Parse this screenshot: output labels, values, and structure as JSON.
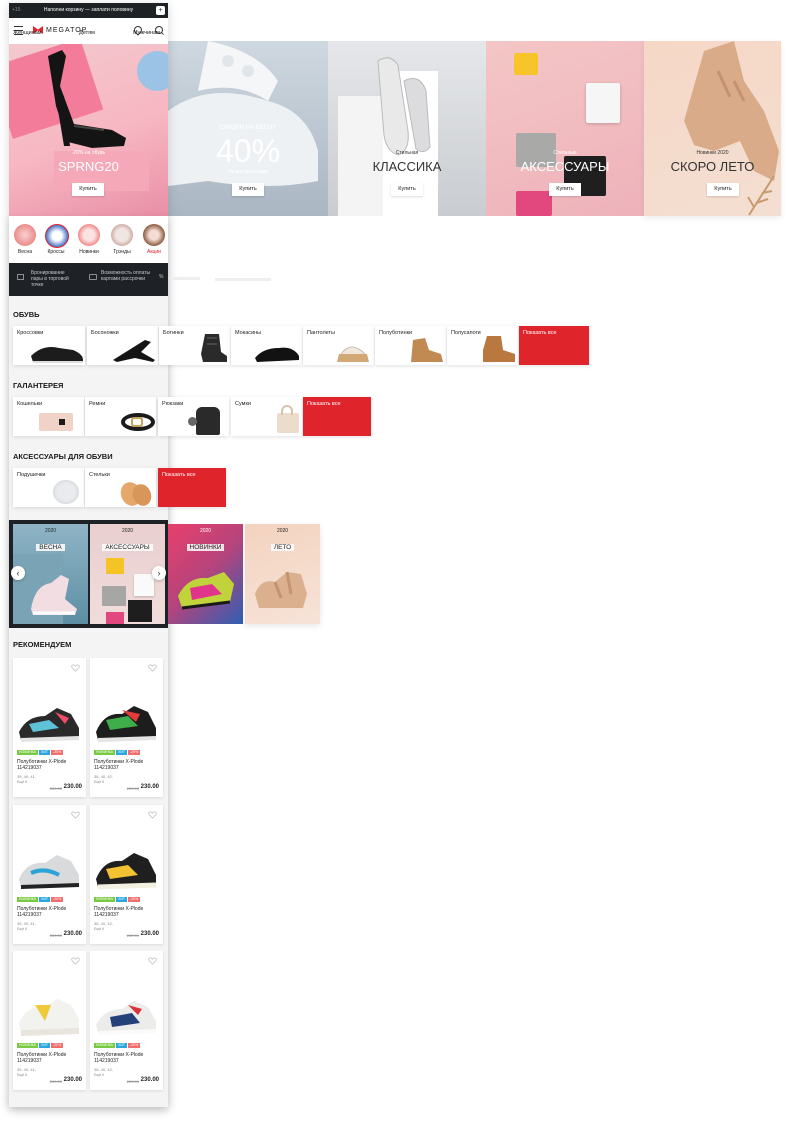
{
  "topbar": {
    "left": "+15",
    "text": "Наполни корзину — заплати половину",
    "right": "+"
  },
  "header": {
    "logo": "MEGATOP"
  },
  "nav": {
    "women": "Женщинам",
    "kids": "Детям",
    "men": "Мужчинам"
  },
  "banners": [
    {
      "sub": "-20% на обувь",
      "big": "SPRNG20",
      "button": "Купить"
    },
    {
      "sub": "СКИДКИ НА ВЕСНУ",
      "big": "40%",
      "sub2": "На все кроссовки",
      "button": "Купить"
    },
    {
      "sub": "Стильная",
      "big": "КЛАССИКА",
      "button": "Купить"
    },
    {
      "sub": "Стильные",
      "big": "АКСЕССУАРЫ",
      "button": "Купить"
    },
    {
      "sub": "Новинки 2020",
      "big": "СКОРО ЛЕТО",
      "button": "Купить"
    }
  ],
  "categories": [
    {
      "label": "Весна"
    },
    {
      "label": "Кроссы"
    },
    {
      "label": "Новинки"
    },
    {
      "label": "Трэнды"
    },
    {
      "label": "Акции"
    }
  ],
  "info": {
    "item1": "Бронирование пары в торговой точке",
    "item2": "Возможность оплаты картами рассрочки",
    "item3": "%"
  },
  "sections": {
    "shoes": {
      "title": "ОБУВЬ",
      "items": [
        "Кроссовки",
        "Босоножки",
        "Ботинки",
        "Мокасины",
        "Пантолеты",
        "Полуботинки",
        "Полусапоги"
      ],
      "show_all": "Показать все"
    },
    "haberdashery": {
      "title": "ГАЛАНТЕРЕЯ",
      "items": [
        "Кошельки",
        "Ремни",
        "Рюкзаки",
        "Сумки"
      ],
      "show_all": "Показать все"
    },
    "accessories": {
      "title": "АКСЕССУАРЫ ДЛЯ ОБУВИ",
      "items": [
        "Подушечки",
        "Стельки"
      ],
      "show_all": "Показать все"
    }
  },
  "promos": [
    {
      "year": "2020",
      "name": "ВЕСНА"
    },
    {
      "year": "2020",
      "name": "АКСЕССУАРЫ"
    },
    {
      "year": "2020",
      "name": "НОВИНКИ"
    },
    {
      "year": "2020",
      "name": "ЛЕТО"
    }
  ],
  "recommend": {
    "title": "РЕКОМЕНДУЕМ",
    "badges": [
      "НОВИНКА",
      "ХИТ",
      "-20%"
    ],
    "products": [
      {
        "name": "Полуботинки X-Plode 114219037",
        "sizes": "39, 40, 41,",
        "more": "Ещё 6",
        "old": "280.00",
        "price": "230.00"
      },
      {
        "name": "Полуботинки X-Plode 114219037",
        "sizes": "38, 40, 42,",
        "more": "Ещё 6",
        "old": "280.00",
        "price": "230.00"
      },
      {
        "name": "Полуботинки X-Plode 114219037",
        "sizes": "39, 40, 41,",
        "more": "Ещё 6",
        "old": "280.00",
        "price": "230.00"
      },
      {
        "name": "Полуботинки X-Plode 114219037",
        "sizes": "38, 40, 42,",
        "more": "Ещё 6",
        "old": "280.00",
        "price": "230.00"
      },
      {
        "name": "Полуботинки X-Plode 114219037",
        "sizes": "39, 40, 41,",
        "more": "Ещё 6",
        "old": "280.00",
        "price": "230.00"
      },
      {
        "name": "Полуботинки X-Plode 114219037",
        "sizes": "38, 40, 42,",
        "more": "Ещё 6",
        "old": "280.00",
        "price": "230.00"
      }
    ]
  },
  "colors": {
    "brand_red": "#e0242c",
    "dark": "#1e2226",
    "badge_new": "#7ac943",
    "badge_hit": "#29a8e0",
    "badge_sale": "#f26d6d"
  }
}
